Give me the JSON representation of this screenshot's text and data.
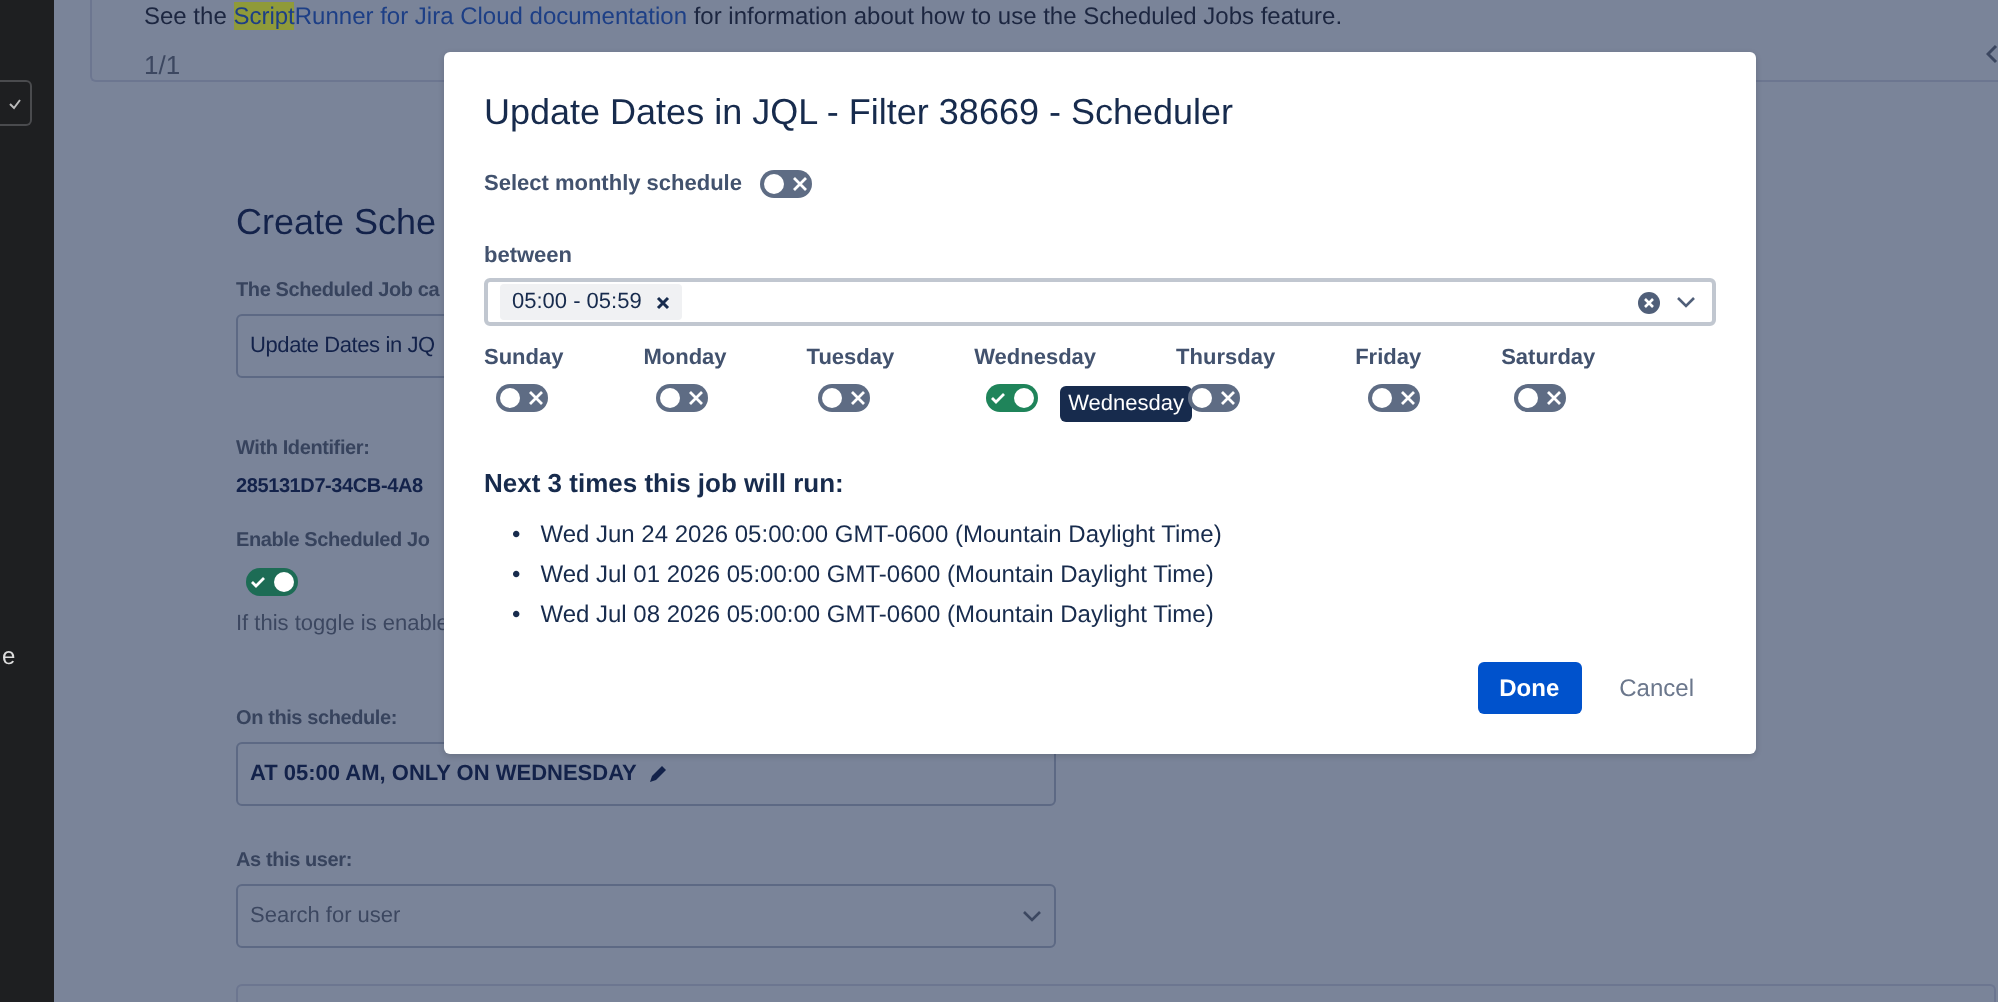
{
  "sidebar": {
    "text_fragment": "e"
  },
  "background_page": {
    "notice": {
      "prefix": "See the ",
      "highlight": "Script",
      "link": "Runner for Jira Cloud documentation",
      "suffix": " for information about how to use the Scheduled Jobs feature."
    },
    "page_count": "1/1",
    "heading": "Create Sche",
    "name_label": "The Scheduled Job ca",
    "name_value": "Update Dates in JQ",
    "identifier_label": "With Identifier:",
    "identifier_value": "285131D7-34CB-4A8",
    "enable_label": "Enable Scheduled Jo",
    "enable_on": true,
    "enable_help": "If this toggle is enable",
    "schedule_label": "On this schedule:",
    "schedule_value": "AT 05:00 AM, ONLY ON WEDNESDAY",
    "user_label": "As this user:",
    "user_placeholder": "Search for user"
  },
  "modal": {
    "title": "Update Dates in JQL - Filter 38669 - Scheduler",
    "monthly": {
      "label": "Select monthly schedule",
      "on": false
    },
    "between": {
      "label": "between",
      "chips": [
        "05:00 - 05:59"
      ]
    },
    "days": [
      {
        "label": "Sunday",
        "on": false
      },
      {
        "label": "Monday",
        "on": false
      },
      {
        "label": "Tuesday",
        "on": false
      },
      {
        "label": "Wednesday",
        "on": true,
        "tooltip": "Wednesday"
      },
      {
        "label": "Thursday",
        "on": false
      },
      {
        "label": "Friday",
        "on": false
      },
      {
        "label": "Saturday",
        "on": false
      }
    ],
    "next_runs": {
      "heading": "Next 3 times this job will run:",
      "items": [
        {
          "marker": "•",
          "text": "Wed Jun 24 2026 05:00:00 GMT-0600 (Mountain Daylight Time)"
        },
        {
          "marker": "•",
          "text": "Wed Jul 01 2026 05:00:00 GMT-0600 (Mountain Daylight Time)"
        },
        {
          "marker": "•",
          "text": "Wed Jul 08 2026 05:00:00 GMT-0600 (Mountain Daylight Time)"
        }
      ]
    },
    "buttons": [
      {
        "label": "Done",
        "kind": "primary"
      },
      {
        "label": "Cancel",
        "kind": "subtle"
      }
    ]
  }
}
